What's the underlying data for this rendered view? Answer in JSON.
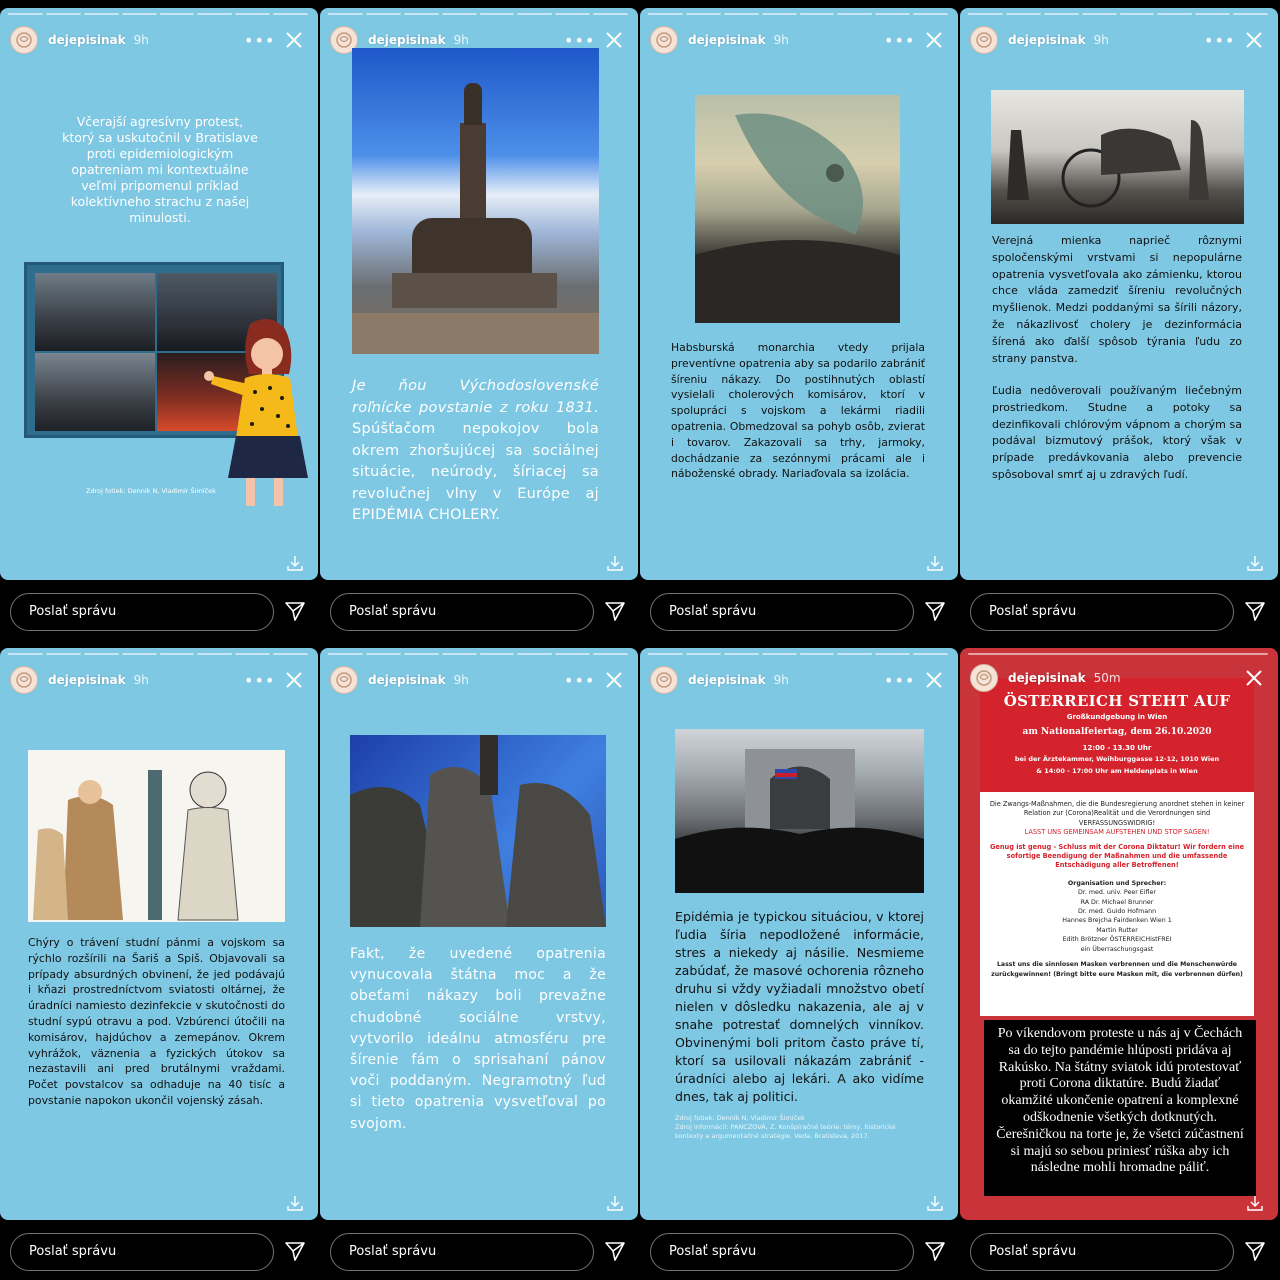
{
  "account": {
    "username": "dejepisinak"
  },
  "reply_placeholder": "Poslať správu",
  "stories": [
    {
      "time": "9h",
      "text": "Včerajší agresívny protest, ktorý sa uskutočnil v Bratislave proti epidemiologickým opatreniam mi kontextuálne veľmi pripomenul príklad kolektívneho strachu z našej minulosti.",
      "caption": "Zdroj fotiek: Denník N, Vladimír Šimíček"
    },
    {
      "time": "9h",
      "text_italic": "Je ňou Východoslovenské roľnícke povstanie z roku 1831.",
      "text": "Spúšťačom nepokojov bola okrem zhoršujúcej sa sociálnej situácie, neúrody, šíriacej sa revolučnej vlny v Európe aj EPIDÉMIA CHOLERY."
    },
    {
      "time": "9h",
      "text": "Habsburská monarchia vtedy prijala preventívne opatrenia aby sa podarilo zabrániť šíreniu nákazy. Do postihnutých oblastí vysielali cholerových komisárov, ktorí v spolupráci s vojskom a lekármi riadili opatrenia. Obmedzoval sa pohyb osôb, zvierat i tovarov. Zakazovali sa trhy, jarmoky, dochádzanie za sezónnymi prácami ale i náboženské obrady. Nariaďovala sa izolácia."
    },
    {
      "time": "9h",
      "text_1": "Verejná mienka naprieč rôznymi spoločenskými vrstvami si nepopulárne opatrenia vysvetľovala ako zámienku, ktorou chce vláda zamedziť šíreniu revolučných myšlienok. Medzi poddanými sa šírili názory, že nákazlivosť cholery je dezinformácia šírená ako ďalší spôsob týrania ľudu zo strany panstva.",
      "text_2": "Ľudia nedôverovali používaným liečebným prostriedkom. Studne a potoky sa dezinfikovali chlórovým vápnom a chorým sa podával bizmutový prášok, ktorý však v prípade predávkovania alebo prevencie spôsoboval smrť aj u zdravých ľudí."
    },
    {
      "time": "9h",
      "text": "Chýry o trávení studní pánmi a vojskom sa rýchlo rozšírili na Šariš a Spiš. Objavovali sa prípady absurdných obvinení, že jed podávajú i kňazi prostredníctvom sviatosti oltárnej, že úradníci namiesto dezinfekcie v skutočnosti do studní sypú otravu a pod. Vzbúrenci útočili na komisárov, hajdúchov a zemepánov. Okrem vyhrážok, väznenia a fyzických útokov sa nezastavili ani pred brutálnymi vraždami. Počet povstalcov sa odhaduje na 40 tisíc a povstanie napokon ukončil vojenský zásah."
    },
    {
      "time": "9h",
      "text": "Fakt, že uvedené opatrenia vynucovala štátna moc a že obeťami nákazy boli prevažne chudobné sociálne vrstvy, vytvorilo ideálnu atmosféru pre šírenie fám o sprisahaní pánov voči poddaným. Negramotný ľud si tieto opatrenia vysvetľoval po svojom."
    },
    {
      "time": "9h",
      "text": "Epidémia je typickou situáciou, v ktorej ľudia šíria nepodložené informácie, stres a niekedy aj násilie. Nesmieme zabúdať, že masové ochorenia rôzneho druhu si vždy vyžiadali množstvo obetí nielen v dôsledku nakazenia, ale aj v snahe potrestať domnelých vinníkov. Obvinenými boli pritom často práve tí, ktorí sa usilovali nákazám zabrániť - úradníci alebo aj lekári. A ako vidíme dnes, tak aj politici.",
      "sources": [
        "Zdroj fotiek: Denník N, Vladimír Šimíček",
        "Zdroj informácií: PANCZOVÁ, Z. Konšpiračné teórie: témy, historické kontexty a argumentačné stratégie. Veda. Bratislava, 2017."
      ]
    },
    {
      "time": "50m",
      "poster": {
        "title": "ÖSTERREICH STEHT AUF",
        "subtitle": "Großkundgebung in Wien",
        "date": "am Nationalfeiertag, dem 26.10.2020",
        "line1": "12:00 - 13.30 Uhr",
        "line2": "bei der Ärztekammer, Weihburggasse 12-12, 1010 Wien",
        "line3": "& 14:00 - 17:00 Uhr am Heldenplats in Wien",
        "body1": "Die Zwangs-Maßnahmen, die die Bundesregierung anordnet stehen in keiner Relation zur (Corona)Realität und die Verordnungen sind VERFASSUNGSWIDRIG!",
        "body2": "LASST UNS GEMEINSAM AUFSTEHEN UND STOP SAGEN!",
        "body3": "Genug ist genug - Schluss mit der Corona Diktatur! Wir fordern eine sofortige Beendigung der Maßnahmen und die umfassende Entschädigung aller Betroffenen!",
        "speakers_title": "Organisation und Sprecher:",
        "speakers": [
          "Dr. med. univ. Peer Eifler",
          "RA Dr. Michael Brunner",
          "Dr. med. Guido Hofmann",
          "Hannes Brejcha Fairdenken Wien 1",
          "Martin Rutter",
          "Edith Brötzner ÖSTERREICHistFREI",
          "ein Überraschungsgast"
        ],
        "footer": "Lasst uns die sinnlosen Masken verbrennen und die Menschenwürde zurückgewinnen! (Bringt bitte eure Masken mit, die verbrennen dürfen)"
      },
      "text": "Po víkendovom proteste u nás aj v Čechách sa do tejto pandémie hlúposti pridáva aj Rakúsko. Na štátny sviatok idú protestovať proti Corona diktatúre. Budú žiadať okamžité ukončenie opatrení a komplexné odškodnenie všetkých dotknutých. Čerešničkou na torte je, že všetci zúčastnení si majú so sebou priniesť rúška aby ich následne mohli hromadne páliť."
    }
  ]
}
